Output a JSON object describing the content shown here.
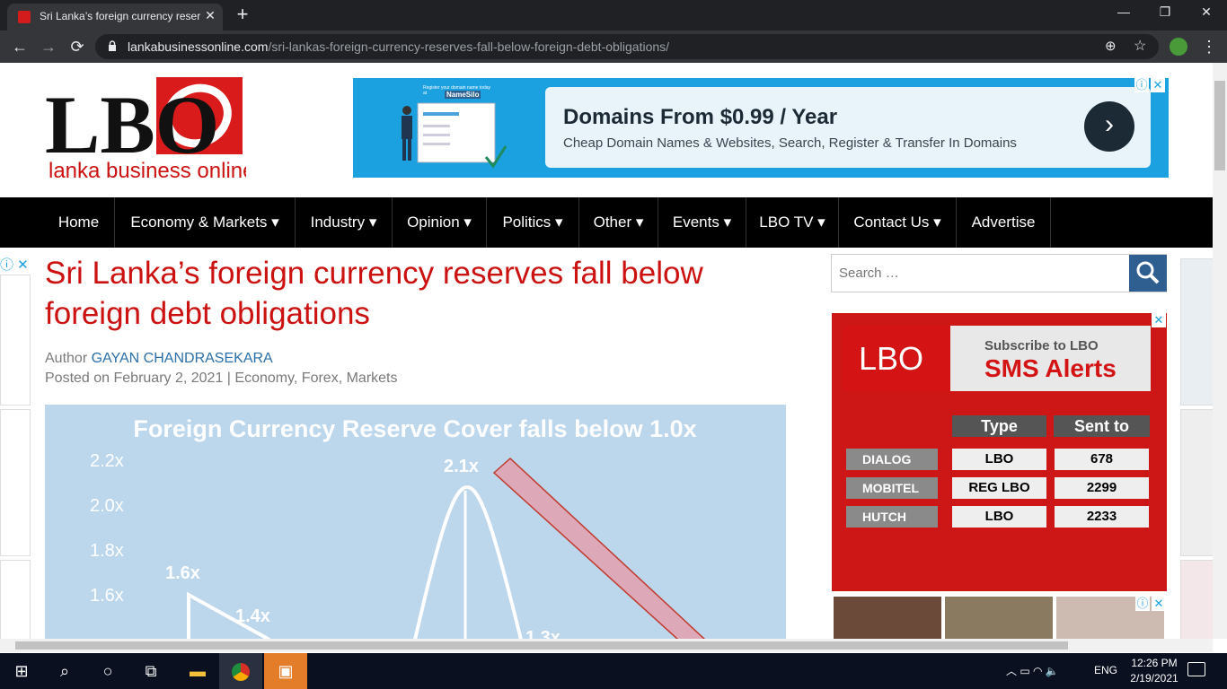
{
  "browser": {
    "tab_title": "Sri Lanka’s foreign currency reser",
    "url_domain": "lankabusinessonline.com",
    "url_path": "/sri-lankas-foreign-currency-reserves-fall-below-foreign-debt-obligations/"
  },
  "logo": {
    "letters": "LBO",
    "tagline": "lanka business online"
  },
  "ad": {
    "brand_small": "Register your domain name today at",
    "brand": "NameSilo",
    "headline": "Domains From $0.99 / Year",
    "subtext": "Cheap Domain Names & Websites, Search, Register & Transfer In Domains"
  },
  "nav": [
    {
      "label": "Home"
    },
    {
      "label": "Economy & Markets ▾"
    },
    {
      "label": "Industry ▾"
    },
    {
      "label": "Opinion ▾"
    },
    {
      "label": "Politics ▾"
    },
    {
      "label": "Other ▾"
    },
    {
      "label": "Events ▾"
    },
    {
      "label": "LBO TV ▾"
    },
    {
      "label": "Contact Us ▾"
    },
    {
      "label": "Advertise"
    }
  ],
  "article": {
    "title": "Sri Lanka’s foreign currency reserves fall below foreign debt obligations",
    "author_prefix": "Author ",
    "author": "GAYAN CHANDRASEKARA",
    "posted_prefix": "Posted on February 2, 2021 | ",
    "categories": "Economy, Forex, Markets"
  },
  "chart_data": {
    "type": "line",
    "title": "Foreign Currency Reserve Cover falls below 1.0x",
    "ytick_labels": [
      "2.2x",
      "2.0x",
      "1.8x",
      "1.6x"
    ],
    "ylim": [
      1.4,
      2.2
    ],
    "point_labels": [
      "1.6x",
      "1.4x",
      "2.1x",
      "1.3x"
    ]
  },
  "sidebar": {
    "search_placeholder": "Search …",
    "sms": {
      "logo": "LBO",
      "sub": "Subscribe to LBO",
      "title": "SMS Alerts",
      "col_type": "Type",
      "col_sent": "Sent to",
      "rows": [
        {
          "op": "DIALOG",
          "type": "LBO",
          "to": "678"
        },
        {
          "op": "MOBITEL",
          "type": "REG LBO",
          "to": "2299"
        },
        {
          "op": "HUTCH",
          "type": "LBO",
          "to": "2233"
        }
      ]
    }
  },
  "taskbar": {
    "time": "12:26 PM",
    "date": "2/19/2021",
    "lang": "ENG"
  }
}
